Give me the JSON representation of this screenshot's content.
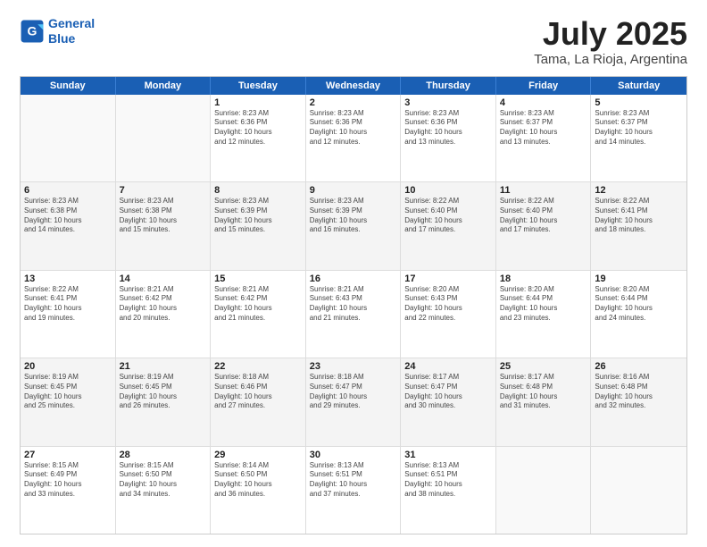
{
  "logo": {
    "line1": "General",
    "line2": "Blue"
  },
  "title": "July 2025",
  "subtitle": "Tama, La Rioja, Argentina",
  "days": [
    "Sunday",
    "Monday",
    "Tuesday",
    "Wednesday",
    "Thursday",
    "Friday",
    "Saturday"
  ],
  "rows": [
    [
      {
        "day": "",
        "text": ""
      },
      {
        "day": "",
        "text": ""
      },
      {
        "day": "1",
        "text": "Sunrise: 8:23 AM\nSunset: 6:36 PM\nDaylight: 10 hours\nand 12 minutes."
      },
      {
        "day": "2",
        "text": "Sunrise: 8:23 AM\nSunset: 6:36 PM\nDaylight: 10 hours\nand 12 minutes."
      },
      {
        "day": "3",
        "text": "Sunrise: 8:23 AM\nSunset: 6:36 PM\nDaylight: 10 hours\nand 13 minutes."
      },
      {
        "day": "4",
        "text": "Sunrise: 8:23 AM\nSunset: 6:37 PM\nDaylight: 10 hours\nand 13 minutes."
      },
      {
        "day": "5",
        "text": "Sunrise: 8:23 AM\nSunset: 6:37 PM\nDaylight: 10 hours\nand 14 minutes."
      }
    ],
    [
      {
        "day": "6",
        "text": "Sunrise: 8:23 AM\nSunset: 6:38 PM\nDaylight: 10 hours\nand 14 minutes."
      },
      {
        "day": "7",
        "text": "Sunrise: 8:23 AM\nSunset: 6:38 PM\nDaylight: 10 hours\nand 15 minutes."
      },
      {
        "day": "8",
        "text": "Sunrise: 8:23 AM\nSunset: 6:39 PM\nDaylight: 10 hours\nand 15 minutes."
      },
      {
        "day": "9",
        "text": "Sunrise: 8:23 AM\nSunset: 6:39 PM\nDaylight: 10 hours\nand 16 minutes."
      },
      {
        "day": "10",
        "text": "Sunrise: 8:22 AM\nSunset: 6:40 PM\nDaylight: 10 hours\nand 17 minutes."
      },
      {
        "day": "11",
        "text": "Sunrise: 8:22 AM\nSunset: 6:40 PM\nDaylight: 10 hours\nand 17 minutes."
      },
      {
        "day": "12",
        "text": "Sunrise: 8:22 AM\nSunset: 6:41 PM\nDaylight: 10 hours\nand 18 minutes."
      }
    ],
    [
      {
        "day": "13",
        "text": "Sunrise: 8:22 AM\nSunset: 6:41 PM\nDaylight: 10 hours\nand 19 minutes."
      },
      {
        "day": "14",
        "text": "Sunrise: 8:21 AM\nSunset: 6:42 PM\nDaylight: 10 hours\nand 20 minutes."
      },
      {
        "day": "15",
        "text": "Sunrise: 8:21 AM\nSunset: 6:42 PM\nDaylight: 10 hours\nand 21 minutes."
      },
      {
        "day": "16",
        "text": "Sunrise: 8:21 AM\nSunset: 6:43 PM\nDaylight: 10 hours\nand 21 minutes."
      },
      {
        "day": "17",
        "text": "Sunrise: 8:20 AM\nSunset: 6:43 PM\nDaylight: 10 hours\nand 22 minutes."
      },
      {
        "day": "18",
        "text": "Sunrise: 8:20 AM\nSunset: 6:44 PM\nDaylight: 10 hours\nand 23 minutes."
      },
      {
        "day": "19",
        "text": "Sunrise: 8:20 AM\nSunset: 6:44 PM\nDaylight: 10 hours\nand 24 minutes."
      }
    ],
    [
      {
        "day": "20",
        "text": "Sunrise: 8:19 AM\nSunset: 6:45 PM\nDaylight: 10 hours\nand 25 minutes."
      },
      {
        "day": "21",
        "text": "Sunrise: 8:19 AM\nSunset: 6:45 PM\nDaylight: 10 hours\nand 26 minutes."
      },
      {
        "day": "22",
        "text": "Sunrise: 8:18 AM\nSunset: 6:46 PM\nDaylight: 10 hours\nand 27 minutes."
      },
      {
        "day": "23",
        "text": "Sunrise: 8:18 AM\nSunset: 6:47 PM\nDaylight: 10 hours\nand 29 minutes."
      },
      {
        "day": "24",
        "text": "Sunrise: 8:17 AM\nSunset: 6:47 PM\nDaylight: 10 hours\nand 30 minutes."
      },
      {
        "day": "25",
        "text": "Sunrise: 8:17 AM\nSunset: 6:48 PM\nDaylight: 10 hours\nand 31 minutes."
      },
      {
        "day": "26",
        "text": "Sunrise: 8:16 AM\nSunset: 6:48 PM\nDaylight: 10 hours\nand 32 minutes."
      }
    ],
    [
      {
        "day": "27",
        "text": "Sunrise: 8:15 AM\nSunset: 6:49 PM\nDaylight: 10 hours\nand 33 minutes."
      },
      {
        "day": "28",
        "text": "Sunrise: 8:15 AM\nSunset: 6:50 PM\nDaylight: 10 hours\nand 34 minutes."
      },
      {
        "day": "29",
        "text": "Sunrise: 8:14 AM\nSunset: 6:50 PM\nDaylight: 10 hours\nand 36 minutes."
      },
      {
        "day": "30",
        "text": "Sunrise: 8:13 AM\nSunset: 6:51 PM\nDaylight: 10 hours\nand 37 minutes."
      },
      {
        "day": "31",
        "text": "Sunrise: 8:13 AM\nSunset: 6:51 PM\nDaylight: 10 hours\nand 38 minutes."
      },
      {
        "day": "",
        "text": ""
      },
      {
        "day": "",
        "text": ""
      }
    ]
  ]
}
